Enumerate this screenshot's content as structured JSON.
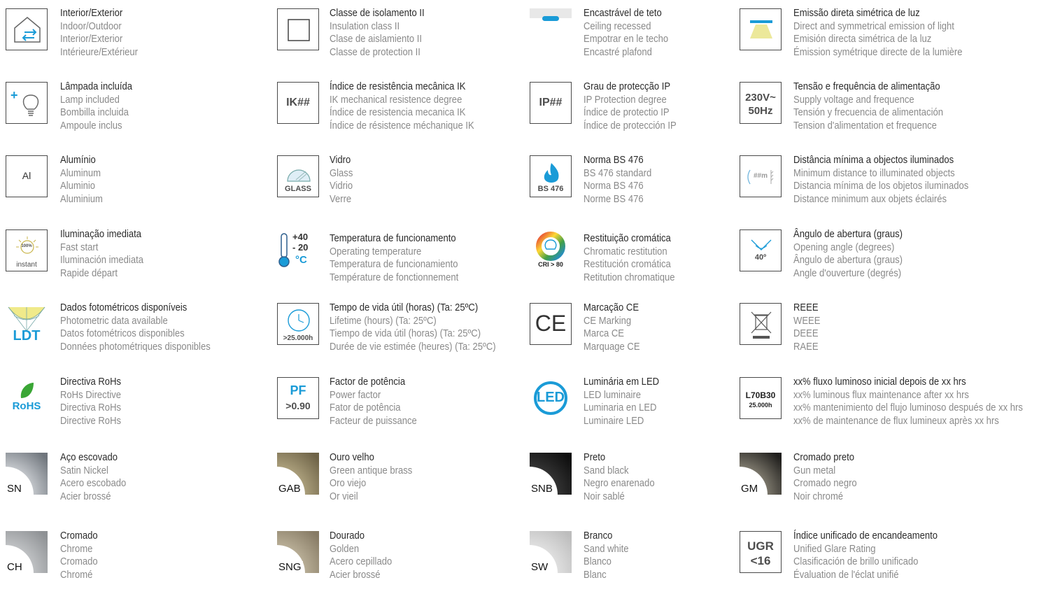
{
  "colors": {
    "accent_blue": "#1a9bd7",
    "green": "#3aa635",
    "label_dark": "#2b2b2b",
    "label_gray": "#8a8a8a"
  },
  "items": [
    {
      "icon": "indoor-outdoor-icon",
      "lines": [
        "Interior/Exterior",
        "Indoor/Outdoor",
        "Interior/Exterior",
        "Intérieure/Extérieur"
      ]
    },
    {
      "icon": "insulation-class-ii-icon",
      "lines": [
        "Classe de isolamento II",
        "Insulation class II",
        "Clase de aislamiento II",
        "Classe de protection II"
      ]
    },
    {
      "icon": "ceiling-recessed-icon",
      "lines": [
        "Encastrável de teto",
        "Ceiling recessed",
        "Empotrar en le techo",
        "Encastré plafond"
      ]
    },
    {
      "icon": "direct-symmetric-emission-icon",
      "lines": [
        "Emissão direta simétrica de luz",
        "Direct and symmetrical emission of light",
        "Emisión directa simétrica de la luz",
        "Émission symétrique directe de la lumière"
      ]
    },
    {
      "icon": "lamp-included-icon",
      "lines": [
        "Lâmpada incluída",
        "Lamp included",
        "Bombilla incluida",
        "Ampoule inclus"
      ]
    },
    {
      "icon": "ik-rating-icon",
      "badge": "IK##",
      "lines": [
        "Índice de resistência mecânica IK",
        "IK mechanical resistence degree",
        "Índice de resistencia mecanica IK",
        "Índice de résistence méchanique IK"
      ]
    },
    {
      "icon": "ip-rating-icon",
      "badge": "IP##",
      "lines": [
        "Grau de protecção IP",
        "IP Protection degree",
        "Índice de protectio IP",
        "Índice de protección IP"
      ]
    },
    {
      "icon": "supply-voltage-icon",
      "badge": "230V~",
      "badge2": "50Hz",
      "lines": [
        "Tensão e frequência de alimentação",
        "Supply voltage and frequence",
        "Tensión y frecuencia de alimentación",
        "Tension d'alimentation et frequence"
      ]
    },
    {
      "icon": "aluminium-icon",
      "badge": "Al",
      "lines": [
        "Alumínio",
        "Aluminum",
        "Aluminio",
        "Aluminium"
      ]
    },
    {
      "icon": "glass-icon",
      "badge": "GLASS",
      "lines": [
        "Vidro",
        "Glass",
        "Vidrio",
        "Verre"
      ]
    },
    {
      "icon": "bs476-flame-icon",
      "badge": "BS 476",
      "lines": [
        "Norma BS 476",
        "BS 476 standard",
        "Norma BS 476",
        "Norme BS 476"
      ]
    },
    {
      "icon": "min-distance-icon",
      "badge": "##m",
      "lines": [
        "Distância mínima a objectos iluminados",
        "Minimum distance to illuminated objects",
        "Distancia mínima de los objetos iluminados",
        "Distance minimum aux objets éclairés"
      ]
    },
    {
      "icon": "instant-start-icon",
      "badge": "100%",
      "badge2": "instant",
      "lines": [
        "Iluminação imediata",
        "Fast start",
        "Iluminación imediata",
        "Rapide départ"
      ]
    },
    {
      "icon": "operating-temperature-icon",
      "badge": "+40",
      "badge2": "- 20",
      "badge3": "°C",
      "lines": [
        "Temperatura de funcionamento",
        "Operating temperature",
        "Temperatura de funcionamiento",
        "Température de fonctionnement"
      ]
    },
    {
      "icon": "cri-icon",
      "badge": "CRI > 80",
      "lines": [
        "Restituição cromática",
        "Chromatic restitution",
        "Restitución cromática",
        "Retitution chromatique"
      ]
    },
    {
      "icon": "opening-angle-icon",
      "badge": "40º",
      "lines": [
        "Ângulo de abertura (graus)",
        "Opening angle (degrees)",
        "Ângulo de abertura (graus)",
        "Angle d'ouverture (degrés)"
      ]
    },
    {
      "icon": "photometric-data-icon",
      "badge": "LDT",
      "lines": [
        "Dados fotométricos disponíveis",
        "Photometric data available",
        "Datos fotométricos disponibles",
        "Données photométriques disponibles"
      ]
    },
    {
      "icon": "lifetime-clock-icon",
      "badge": ">25.000h",
      "lines": [
        "Tempo de vida útil (horas) (Ta: 25ºC)",
        "Lifetime (hours) (Ta: 25ºC)",
        "Tiempo de vida útil (horas) (Ta: 25ºC)",
        "Durée de vie estimée (heures) (Ta: 25ºC)"
      ]
    },
    {
      "icon": "ce-marking-icon",
      "badge": "CE",
      "lines": [
        "Marcação CE",
        "CE Marking",
        "Marca CE",
        "Marquage CE"
      ]
    },
    {
      "icon": "weee-bin-icon",
      "lines": [
        "REEE",
        "WEEE",
        "DEEE",
        "RAEE"
      ]
    },
    {
      "icon": "rohs-leaf-icon",
      "badge": "RoHS",
      "lines": [
        "Directiva RoHs",
        "RoHs Directive",
        "Directiva RoHs",
        "Directive RoHs"
      ]
    },
    {
      "icon": "power-factor-icon",
      "badge": "PF",
      "badge2": ">0.90",
      "lines": [
        "Factor de potência",
        "Power factor",
        "Fator de potência",
        "Facteur de puissance"
      ]
    },
    {
      "icon": "led-luminaire-icon",
      "badge": "LED",
      "lines": [
        "Luminária em LED",
        "LED luminaire",
        "Luminaria en LED",
        "Luminaire LED"
      ]
    },
    {
      "icon": "lumen-maintenance-icon",
      "badge": "L70B30",
      "badge2": "25.000h",
      "lines": [
        "xx% fluxo luminoso inicial depois de xx hrs",
        "xx% luminous flux maintenance after xx hrs",
        "xx% mantenimiento del flujo luminoso después de xx hrs",
        "xx% de maintenance de flux lumineux après xx hrs"
      ]
    },
    {
      "icon": "finish-swatch-icon",
      "finish": "SN",
      "swatch": [
        "#6f757c",
        "#d3d6da"
      ],
      "lines": [
        "Aço escovado",
        "Satin Nickel",
        "Acero escobado",
        "Acier brossé"
      ]
    },
    {
      "icon": "finish-swatch-icon",
      "finish": "GAB",
      "swatch": [
        "#6e6347",
        "#b7ab86"
      ],
      "lines": [
        "Ouro velho",
        "Green antique brass",
        "Oro viejo",
        "Or vieil"
      ]
    },
    {
      "icon": "finish-swatch-icon",
      "finish": "SNB",
      "swatch": [
        "#0d0d0d",
        "#3b3b3b"
      ],
      "lines": [
        "Preto",
        "Sand black",
        "Negro enarenado",
        "Noir sablé"
      ]
    },
    {
      "icon": "finish-swatch-icon",
      "finish": "GM",
      "swatch": [
        "#1f1e1c",
        "#8f8a7c"
      ],
      "lines": [
        "Cromado preto",
        "Gun metal",
        "Cromado negro",
        "Noir chromé"
      ]
    },
    {
      "icon": "finish-swatch-icon",
      "finish": "CH",
      "swatch": [
        "#8e9194",
        "#c9cbcd"
      ],
      "lines": [
        "Cromado",
        "Chrome",
        "Cromado",
        "Chromé"
      ]
    },
    {
      "icon": "finish-swatch-icon",
      "finish": "SNG",
      "swatch": [
        "#877b65",
        "#c2b8a0"
      ],
      "lines": [
        "Dourado",
        "Golden",
        "Acero cepillado",
        "Acier brossé"
      ]
    },
    {
      "icon": "finish-swatch-icon",
      "finish": "SW",
      "swatch": [
        "#bdbdbd",
        "#e6e6e6"
      ],
      "lines": [
        "Branco",
        "Sand white",
        "Blanco",
        "Blanc"
      ]
    },
    {
      "icon": "ugr-icon",
      "badge": "UGR",
      "badge2": "<16",
      "lines": [
        "Índice unificado de encandeamento",
        "Unified Glare Rating",
        "Clasificación de brillo unificado",
        "Évaluation de l'éclat unifié"
      ]
    }
  ]
}
